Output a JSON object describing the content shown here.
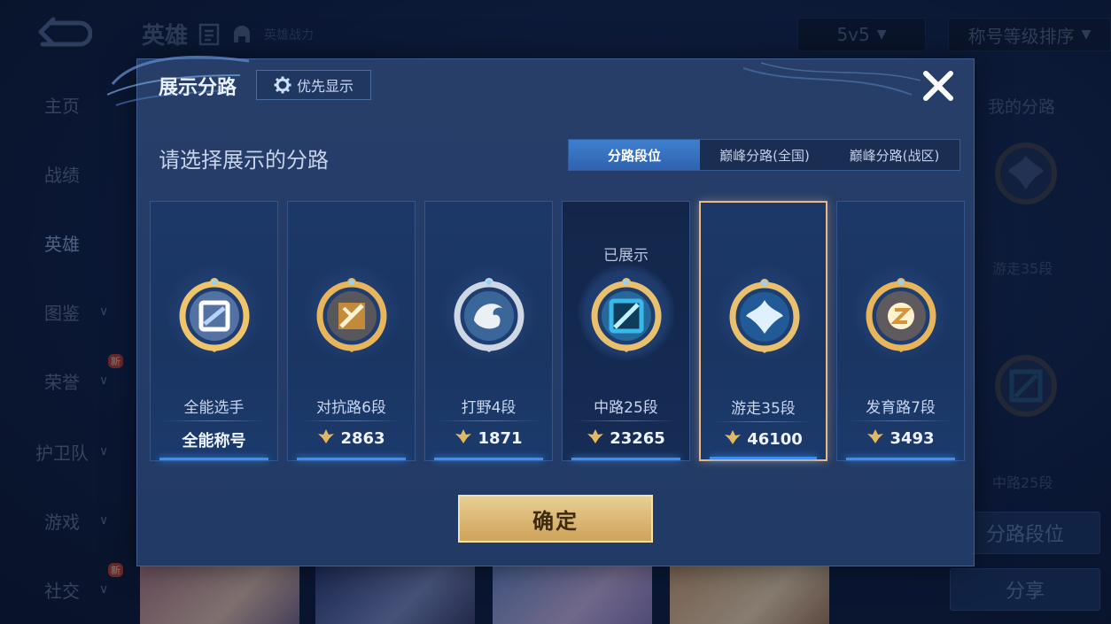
{
  "background": {
    "header": {
      "title": "英雄",
      "power_label": "英雄战力"
    },
    "mode_select": "5v5",
    "sort_select": "称号等级排序",
    "nav": [
      {
        "label": "主页",
        "chevron": false,
        "new": false
      },
      {
        "label": "战绩",
        "chevron": false,
        "new": false
      },
      {
        "label": "英雄",
        "chevron": false,
        "new": false,
        "active": true
      },
      {
        "label": "图鉴",
        "chevron": true,
        "new": false
      },
      {
        "label": "荣誉",
        "chevron": true,
        "new": true
      },
      {
        "label": "护卫队",
        "chevron": true,
        "new": false
      },
      {
        "label": "游戏",
        "chevron": true,
        "new": false
      },
      {
        "label": "社交",
        "chevron": true,
        "new": true
      }
    ],
    "new_badge": "新",
    "right_panel": {
      "title": "我的分路",
      "lane1": "游走35段",
      "lane2": "中路25段",
      "lane_rank_button": "分路段位",
      "share_button": "分享"
    }
  },
  "modal": {
    "title": "展示分路",
    "priority_button": "优先显示",
    "prompt": "请选择展示的分路",
    "tabs": [
      "分路段位",
      "巅峰分路(全国)",
      "巅峰分路(战区)"
    ],
    "active_tab": 0,
    "shown_label": "已展示",
    "cards": [
      {
        "name": "全能选手",
        "score": "全能称号",
        "has_icon": false,
        "dark": false,
        "selected": false,
        "shown": false,
        "medal": "all-round-medal",
        "colors": [
          "#f0c46a",
          "#b7d4ff"
        ]
      },
      {
        "name": "对抗路6段",
        "score": "2863",
        "has_icon": true,
        "dark": false,
        "selected": false,
        "shown": false,
        "medal": "clash-lane-medal",
        "colors": [
          "#e8b55a",
          "#c28a3a"
        ]
      },
      {
        "name": "打野4段",
        "score": "1871",
        "has_icon": true,
        "dark": false,
        "selected": false,
        "shown": false,
        "medal": "jungle-medal",
        "colors": [
          "#cfd7e4",
          "#6fb5e8"
        ]
      },
      {
        "name": "中路25段",
        "score": "23265",
        "has_icon": true,
        "dark": true,
        "selected": false,
        "shown": true,
        "medal": "mid-lane-medal",
        "colors": [
          "#e9c16e",
          "#38b9ec"
        ]
      },
      {
        "name": "游走35段",
        "score": "46100",
        "has_icon": true,
        "dark": false,
        "selected": true,
        "shown": false,
        "medal": "roam-medal",
        "colors": [
          "#e9c16e",
          "#2a8fe0"
        ]
      },
      {
        "name": "发育路7段",
        "score": "3493",
        "has_icon": true,
        "dark": false,
        "selected": false,
        "shown": false,
        "medal": "farm-lane-medal",
        "colors": [
          "#e8b55a",
          "#d8923a"
        ]
      }
    ],
    "confirm_button": "确定"
  }
}
